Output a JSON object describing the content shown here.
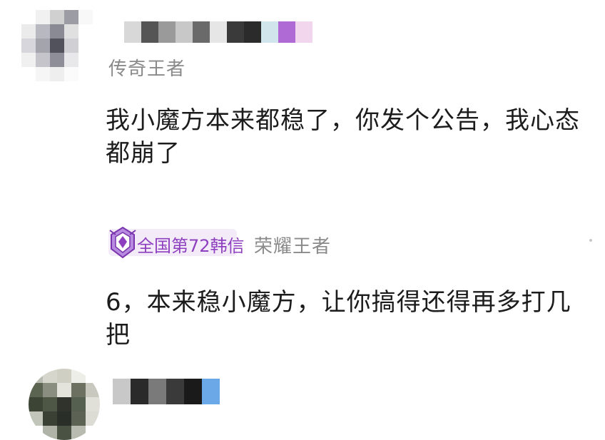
{
  "comments": [
    {
      "rank": "传奇王者",
      "text": "我小魔方本来都稳了，你发个公告，我心态都崩了",
      "avatar_colors": [
        "#ffffff",
        "#f1f1f1",
        "#d0d0d0",
        "#9c9ca4",
        "#f8f8f8",
        "#ebebeb",
        "#b8b8c0",
        "#8a8a94",
        "#e0e0e0",
        "#ffffff",
        "#d6d6dc",
        "#a4a4ac",
        "#52525c",
        "#cfcfd4",
        "#ffffff",
        "#f0f0f0",
        "#c4c4ca",
        "#8e8e98",
        "#e8e8ea",
        "#ffffff",
        "#ffffff",
        "#f6f6f6",
        "#eeeeee",
        "#fbfbfb",
        "#ffffff"
      ],
      "name_colors": [
        "#ffffff",
        "#d8d8d8",
        "#555555",
        "#9a9a9a",
        "#c8c8c8",
        "#6a6a6a",
        "#e6e6e6",
        "#3a3a3a",
        "#2b2b2b",
        "#d0e6ec",
        "#b06ad6",
        "#f2d6ee"
      ]
    },
    {
      "badge": "全国第72韩信",
      "rank": "荣耀王者",
      "text": "6，本来稳小魔方，让你搞得还得再多打几把",
      "avatar_colors": [
        "#b8bcb0",
        "#d6d6cc",
        "#cfcfc4",
        "#eeeee8",
        "#ffffff",
        "#5a6450",
        "#8a8e80",
        "#e4e4dc",
        "#6c7060",
        "#c8c8be",
        "#3c4436",
        "#4e5646",
        "#2f332c",
        "#556050",
        "#e0e0d8",
        "#c2c6ba",
        "#3a4034",
        "#2a2e28",
        "#5c6254",
        "#dcdcd4",
        "#ffffff",
        "#b0b4a8",
        "#4a5244",
        "#b8bcb0",
        "#ffffff"
      ],
      "name_colors": [
        "#c8c8c8",
        "#2a2a2a",
        "#7a7a7a",
        "#3a3a3a",
        "#1a1a1a",
        "#6aa8e8"
      ],
      "accent": "#8e3fbf"
    }
  ]
}
